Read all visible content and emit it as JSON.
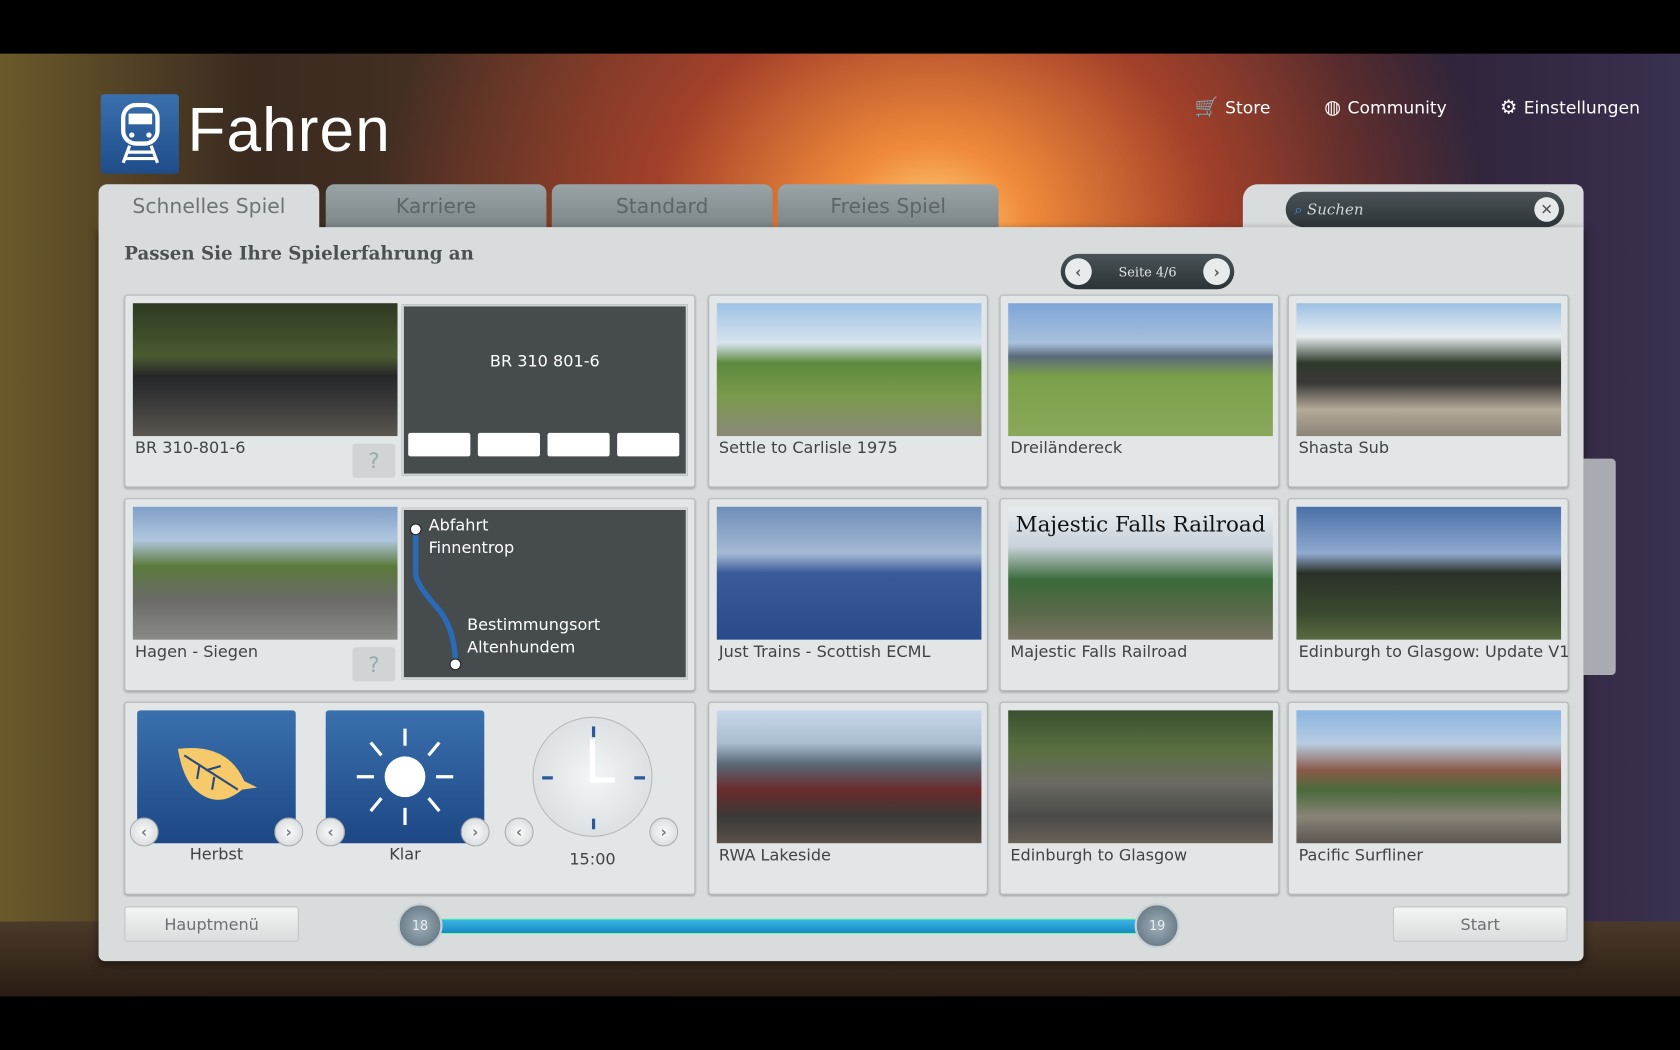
{
  "header": {
    "title": "Fahren",
    "nav": [
      {
        "label": "Store",
        "icon": "cart-icon"
      },
      {
        "label": "Community",
        "icon": "globe-icon"
      },
      {
        "label": "Einstellungen",
        "icon": "gear-icon"
      }
    ]
  },
  "tabs": [
    "Schnelles Spiel",
    "Karriere",
    "Standard",
    "Freies Spiel"
  ],
  "search": {
    "placeholder": "Suchen"
  },
  "heading": "Passen Sie Ihre Spielerfahrung an",
  "pager": {
    "label": "Seite 4/6"
  },
  "quick": {
    "loco": {
      "name": "BR 310-801-6",
      "consist_title": "BR 310 801-6",
      "wagons": 4
    },
    "route": {
      "name": "Hagen - Siegen",
      "departure_label": "Abfahrt",
      "departure": "Finnentrop",
      "destination_label": "Bestimmungsort",
      "destination": "Altenhundem"
    },
    "season": "Herbst",
    "weather": "Klar",
    "time": "15:00",
    "help": "?"
  },
  "routes": [
    "Settle to Carlisle 1975",
    "Dreiländereck",
    "Shasta Sub",
    "Just Trains - Scottish ECML",
    "Majestic Falls Railroad",
    "Edinburgh to Glasgow: Update V1",
    "RWA Lakeside",
    "Edinburgh to Glasgow",
    "Pacific Surfliner"
  ],
  "thumb_banner": "Majestic Falls Railroad",
  "footer": {
    "main_menu": "Hauptmenü",
    "start": "Start",
    "slider_min": "18",
    "slider_max": "19",
    "slider_fill_percent": 93
  }
}
